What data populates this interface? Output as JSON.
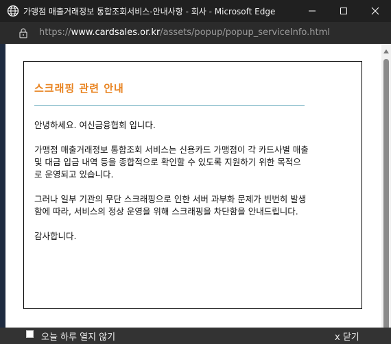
{
  "window": {
    "title": "가맹점 매출거래정보 통합조회서비스-안내사항 - 회사 - Microsoft Edge",
    "buttons": [
      "minimize-icon",
      "maximize-icon",
      "close-icon"
    ]
  },
  "address": {
    "scheme": "https://",
    "host": "www.cardsales.or.kr",
    "path": "/assets/popup/popup_serviceInfo.html"
  },
  "notice": {
    "title": "스크래핑 관련 안내",
    "paragraphs": [
      "안녕하세요. 여신금융협회 입니다.",
      "가맹점 매출거래정보 통합조회 서비스는 신용카드 가맹점이 각 카드사별 매출 및 대금 입금 내역 등을 종합적으로 확인할 수 있도록 지원하기 위한 목적으로 운영되고 있습니다.",
      "그러나 일부 기관의 무단 스크래핑으로 인한 서버 과부화 문제가 빈번히 발생함에 따라, 서비스의 정상 운영을 위해 스크래핑을 차단함을 안내드립니다.",
      "감사합니다."
    ],
    "title_color": "#e8821e",
    "divider_color": "#5ea5b8"
  },
  "footer": {
    "checkbox_label": "오늘 하루 열지 않기",
    "close_label": "x 닫기"
  }
}
